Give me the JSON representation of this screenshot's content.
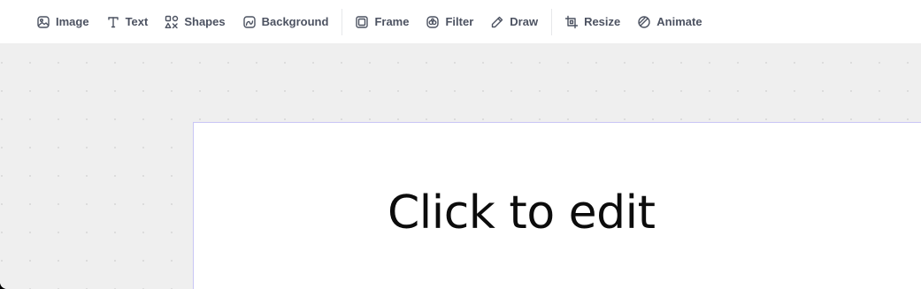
{
  "toolbar": {
    "groups": [
      [
        {
          "label": "Image",
          "icon": "image-icon"
        },
        {
          "label": "Text",
          "icon": "text-icon"
        },
        {
          "label": "Shapes",
          "icon": "shapes-icon"
        },
        {
          "label": "Background",
          "icon": "background-icon"
        }
      ],
      [
        {
          "label": "Frame",
          "icon": "frame-icon"
        },
        {
          "label": "Filter",
          "icon": "filter-icon"
        },
        {
          "label": "Draw",
          "icon": "pencil-icon"
        }
      ],
      [
        {
          "label": "Resize",
          "icon": "crop-icon"
        },
        {
          "label": "Animate",
          "icon": "animate-icon"
        }
      ]
    ]
  },
  "canvas": {
    "placeholder_text": "Click to edit"
  },
  "colors": {
    "toolbar_bg": "#ffffff",
    "canvas_bg": "#efefef",
    "page_border": "#c9c6f5",
    "text": "#4c5261"
  }
}
